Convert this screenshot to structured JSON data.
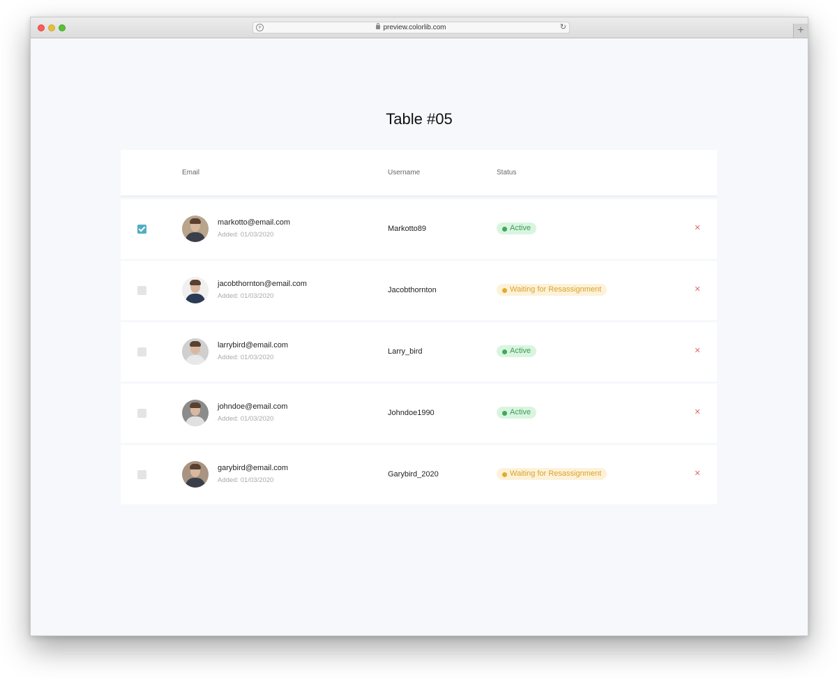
{
  "browser": {
    "url": "preview.colorlib.com",
    "new_tab": "+"
  },
  "page": {
    "title": "Table #05"
  },
  "table": {
    "headers": {
      "email": "Email",
      "username": "Username",
      "status": "Status"
    },
    "rows": [
      {
        "email": "markotto@email.com",
        "added": "Added: 01/03/2020",
        "username": "Markotto89",
        "status": "Active",
        "status_type": "active",
        "checked": true
      },
      {
        "email": "jacobthornton@email.com",
        "added": "Added: 01/03/2020",
        "username": "Jacobthornton",
        "status": "Waiting for Resassignment",
        "status_type": "waiting",
        "checked": false
      },
      {
        "email": "larrybird@email.com",
        "added": "Added: 01/03/2020",
        "username": "Larry_bird",
        "status": "Active",
        "status_type": "active",
        "checked": false
      },
      {
        "email": "johndoe@email.com",
        "added": "Added: 01/03/2020",
        "username": "Johndoe1990",
        "status": "Active",
        "status_type": "active",
        "checked": false
      },
      {
        "email": "garybird@email.com",
        "added": "Added: 01/03/2020",
        "username": "Garybird_2020",
        "status": "Waiting for Resassignment",
        "status_type": "waiting",
        "checked": false
      }
    ]
  },
  "colors": {
    "page_bg": "#f6f8fc",
    "checkbox_checked": "#52aec4",
    "active_green": "#41a95b",
    "waiting_amber": "#e2ab2f",
    "remove_red": "#e36a6a"
  }
}
